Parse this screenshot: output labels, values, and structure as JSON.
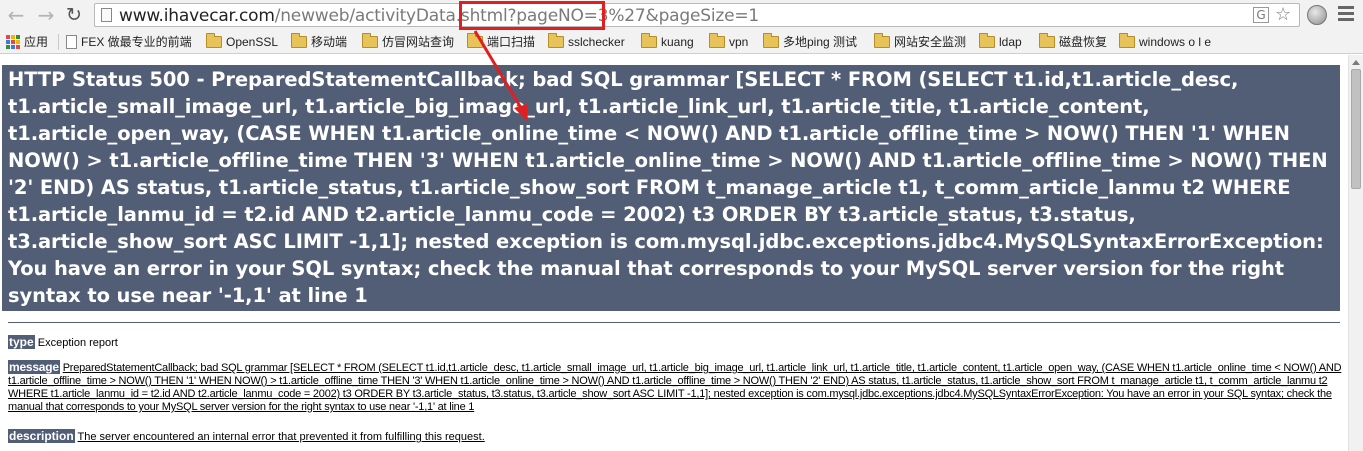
{
  "browser": {
    "url_host": "www.ihavecar.com",
    "url_path": "/newweb/activityData.shtml?pageNO=3%27&pageSize=1",
    "translate_icon": "translate-icon",
    "star_icon": "star-icon"
  },
  "bookmarks": {
    "apps_label": "应用",
    "items": [
      "FEX 做最专业的前端",
      "OpenSSL",
      "移动端",
      "仿冒网站查询",
      "端口扫描",
      "sslchecker",
      "kuang",
      "vpn",
      "多地ping 测试",
      "网站安全监测",
      "ldap",
      "磁盘恢复",
      "windows o l e"
    ]
  },
  "error": {
    "heading": "HTTP Status 500 - PreparedStatementCallback; bad SQL grammar [SELECT * FROM (SELECT t1.id,t1.article_desc, t1.article_small_image_url, t1.article_big_image_url, t1.article_link_url, t1.article_title, t1.article_content, t1.article_open_way, (CASE WHEN t1.article_online_time < NOW() AND t1.article_offline_time > NOW() THEN '1' WHEN NOW() > t1.article_offline_time THEN '3' WHEN t1.article_online_time > NOW() AND t1.article_offline_time > NOW() THEN '2' END) AS status, t1.article_status, t1.article_show_sort FROM t_manage_article t1, t_comm_article_lanmu t2 WHERE t1.article_lanmu_id = t2.id AND t2.article_lanmu_code = 2002) t3 ORDER BY t3.article_status, t3.status, t3.article_show_sort ASC LIMIT -1,1]; nested exception is com.mysql.jdbc.exceptions.jdbc4.MySQLSyntaxErrorException: You have an error in your SQL syntax; check the manual that corresponds to your MySQL server version for the right syntax to use near '-1,1' at line 1",
    "type_label": "type",
    "type_value": "Exception report",
    "message_label": "message",
    "message_value": "PreparedStatementCallback; bad SQL grammar [SELECT * FROM (SELECT t1.id,t1.article_desc, t1.article_small_image_url, t1.article_big_image_url, t1.article_link_url, t1.article_title, t1.article_content, t1.article_open_way, (CASE WHEN t1.article_online_time < NOW() AND t1.article_offline_time > NOW() THEN '1' WHEN NOW() > t1.article_offline_time THEN '3' WHEN t1.article_online_time > NOW() AND t1.article_offline_time > NOW() THEN '2' END) AS status, t1.article_status, t1.article_show_sort FROM t_manage_article t1, t_comm_article_lanmu t2 WHERE t1.article_lanmu_id = t2.id AND t2.article_lanmu_code = 2002) t3 ORDER BY t3.article_status, t3.status, t3.article_show_sort ASC LIMIT -1,1]; nested exception is com.mysql.jdbc.exceptions.jdbc4.MySQLSyntaxErrorException: You have an error in your SQL syntax; check the manual that corresponds to your MySQL server version for the right syntax to use near '-1,1' at line 1",
    "description_label": "description",
    "description_value": "The server encountered an internal error that prevented it from fulfilling this request."
  },
  "colors": {
    "heading_bg": "#525d76",
    "annotation": "#e02020"
  }
}
